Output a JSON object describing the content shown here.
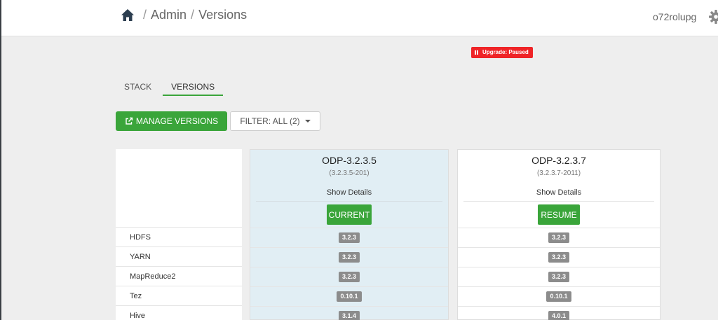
{
  "breadcrumb": {
    "home_icon": "home-icon",
    "items": [
      "Admin",
      "Versions"
    ],
    "separator": "/"
  },
  "user": {
    "name": "o72rolupg",
    "settings_icon": "gear-icon"
  },
  "upgrade_status": {
    "label": "Upgrade: Paused",
    "icon": "pause-icon",
    "color": "#ef2427"
  },
  "tabs": [
    {
      "label": "STACK",
      "active": false
    },
    {
      "label": "VERSIONS",
      "active": true
    }
  ],
  "toolbar": {
    "manage_label": "MANAGE VERSIONS",
    "manage_icon": "external-link-icon",
    "filter_label": "FILTER: ALL (2)"
  },
  "components": [
    "HDFS",
    "YARN",
    "MapReduce2",
    "Tez",
    "Hive"
  ],
  "versions": [
    {
      "name": "ODP-3.2.3.5",
      "build": "(3.2.3.5-201)",
      "details_label": "Show Details",
      "action_label": "CURRENT",
      "component_versions": [
        "3.2.3",
        "3.2.3",
        "3.2.3",
        "0.10.1",
        "3.1.4"
      ]
    },
    {
      "name": "ODP-3.2.3.7",
      "build": "(3.2.3.7-2011)",
      "details_label": "Show Details",
      "action_label": "RESUME",
      "component_versions": [
        "3.2.3",
        "3.2.3",
        "3.2.3",
        "0.10.1",
        "4.0.1"
      ]
    }
  ],
  "colors": {
    "accent_green": "#3aa53a",
    "current_column_bg": "#e1eef4",
    "badge_gray": "#8c8c8c"
  }
}
